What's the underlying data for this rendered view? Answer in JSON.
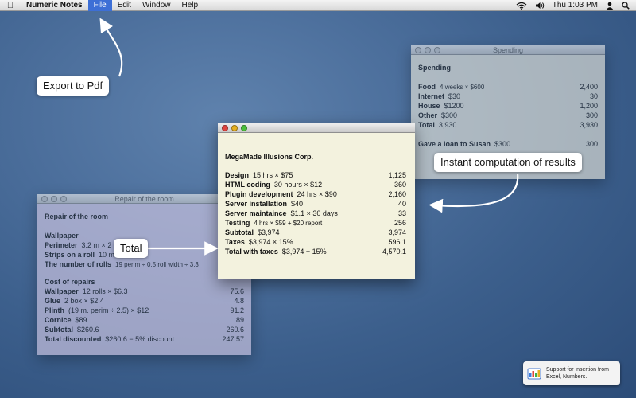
{
  "menubar": {
    "apple_icon": "apple-icon",
    "app_name": "Numeric Notes",
    "menus": [
      "File",
      "Edit",
      "Window",
      "Help"
    ],
    "active_menu": "File",
    "clock": "Thu 1:03 PM"
  },
  "spending": {
    "title": "Spending",
    "heading": "Spending",
    "rows": [
      {
        "label": "Food",
        "expr": "4 weeks × $600",
        "value": "2,400"
      },
      {
        "label": "Internet",
        "expr": "$30",
        "value": "30"
      },
      {
        "label": "House",
        "expr": "$1200",
        "value": "1,200"
      },
      {
        "label": "Other",
        "expr": "$300",
        "value": "300"
      },
      {
        "label": "Total",
        "expr": "3,930",
        "value": "3,930"
      }
    ],
    "loan": {
      "label": "Gave a loan to Susan",
      "expr": "$300",
      "value": "300"
    }
  },
  "repair": {
    "title": "Repair of the room",
    "heading": "Repair of the room",
    "wallpaper_heading": "Wallpaper",
    "wallpaper_rows": [
      {
        "label": "Perimeter",
        "expr": "3.2 m × 2 +",
        "value": ""
      },
      {
        "label": "Strips on a roll",
        "expr": "10 m ÷",
        "value": ""
      },
      {
        "label": "The number of rolls",
        "expr": "19 perim ÷ 0.5 roll width ÷ 3.3",
        "value": ""
      }
    ],
    "cost_heading": "Cost of repairs",
    "cost_rows": [
      {
        "label": "Wallpaper",
        "expr": "12 rolls × $6.3",
        "value": "75.6"
      },
      {
        "label": "Glue",
        "expr": "2 box × $2.4",
        "value": "4.8"
      },
      {
        "label": "Plinth",
        "expr": "(19 m. perim ÷ 2.5) × $12",
        "value": "91.2"
      },
      {
        "label": "Cornice",
        "expr": "$89",
        "value": "89"
      },
      {
        "label": "Subtotal",
        "expr": "$260.6",
        "value": "260.6"
      },
      {
        "label": "Total discounted",
        "expr": "$260.6 − 5% discount",
        "value": "247.57"
      }
    ]
  },
  "megamade": {
    "title": "",
    "heading": "MegaMade Illusions Corp.",
    "rows": [
      {
        "label": "Design",
        "expr": "15 hrs × $75",
        "value": "1,125"
      },
      {
        "label": "HTML coding",
        "expr": "30 hours × $12",
        "value": "360"
      },
      {
        "label": "Plugin development",
        "expr": "24 hrs × $90",
        "value": "2,160"
      },
      {
        "label": "Server installation",
        "expr": "$40",
        "value": "40"
      },
      {
        "label": "Server maintaince",
        "expr": "$1.1 × 30 days",
        "value": "33"
      },
      {
        "label": "Testing",
        "expr": "4 hrs × $59 + $20 report",
        "value": "256"
      },
      {
        "label": "Subtotal",
        "expr": "$3,974",
        "value": "3,974"
      },
      {
        "label": "Taxes",
        "expr": "$3,974 × 15%",
        "value": "596.1"
      },
      {
        "label": "Total with taxes",
        "expr": "$3,974 + 15%",
        "value": "4,570.1"
      }
    ]
  },
  "callouts": {
    "export": "Export to Pdf",
    "instant": "Instant computation of results",
    "total": "Total"
  },
  "notice": {
    "text": "Support for insertion from Excel, Numbers.",
    "icon": "spreadsheet-icon"
  }
}
